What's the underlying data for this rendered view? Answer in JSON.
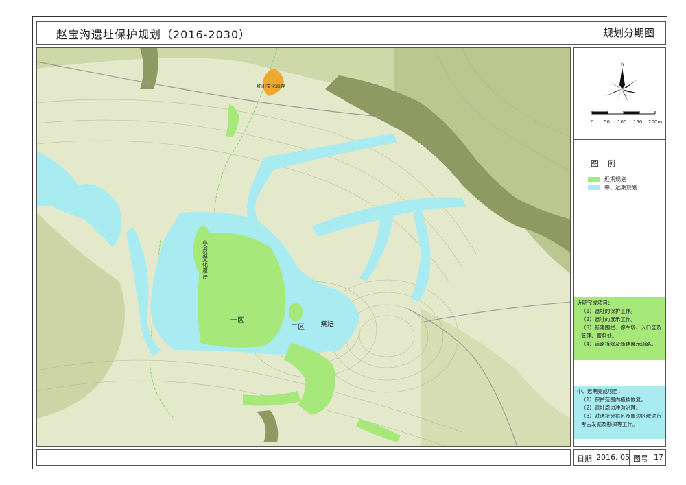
{
  "header": {
    "title": "赵宝沟遗址保护规划（2016-2030）",
    "plan_name": "规划分期图"
  },
  "map": {
    "labels": {
      "hongshan": "红山文化遗存",
      "xiaoheyan": "小河沿文化遗存",
      "zone1": "一区",
      "zone2": "二区",
      "altar": "祭坛"
    },
    "colors": {
      "terrain_light": "#e3e8c9",
      "terrain_mid": "#c9d2a3",
      "terrain_dark": "#8f9a62",
      "near_term": "#a6e87a",
      "mid_long_term": "#a8ecf2",
      "hongshan_site": "#f0a830"
    }
  },
  "compass": {
    "north": "N"
  },
  "scale": {
    "ticks": [
      "0",
      "50",
      "100",
      "150",
      "200m"
    ]
  },
  "legend": {
    "title": "图  例",
    "items": [
      {
        "label": "近期规划",
        "color": "#a6e87a"
      },
      {
        "label": "中、远期规划",
        "color": "#a8ecf2"
      }
    ]
  },
  "near_term_box": {
    "heading": "近期完成项目：",
    "items": [
      "（1）遗址的保护工作。",
      "（2）遗址的展示工作。",
      "（3）新建围栏、停车场、入口区及管理、服务处。",
      "（4）道路拆除及新建展示道路。"
    ]
  },
  "mid_term_box": {
    "heading": "中、远期完成项目：",
    "items": [
      "（1）保护范围内植被恢复。",
      "（2）遗址周边冲沟治理。",
      "（3）对遗址分布区及周边区域进行考古发掘及勘探等工作。"
    ]
  },
  "footer": {
    "date_label": "日期",
    "date_value": "2016. 05",
    "number_label": "图号",
    "number_value": "17"
  }
}
